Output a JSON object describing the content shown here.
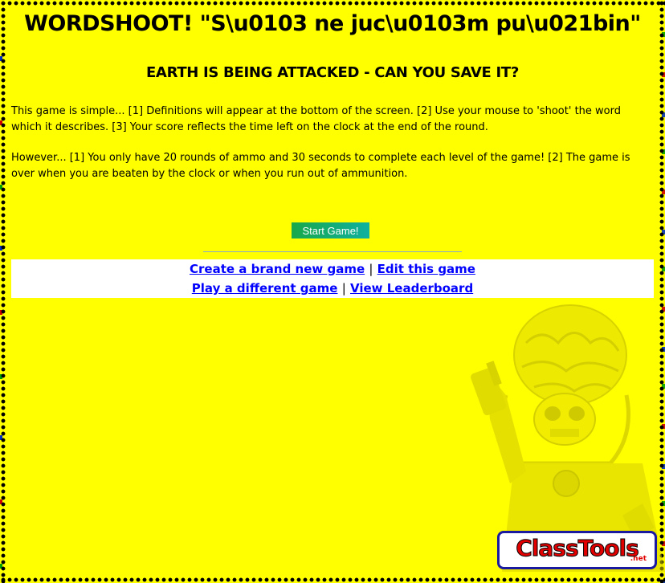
{
  "header": {
    "title": "WORDSHOOT! \"S\\u0103 ne juc\\u0103m pu\\u021bin\"",
    "subtitle": "EARTH IS BEING ATTACKED - CAN YOU SAVE IT?"
  },
  "instructions": {
    "paragraph1": "This game is simple... [1] Definitions will appear at the bottom of the screen. [2] Use your mouse to 'shoot' the word which it describes. [3] Your score reflects the time left on the clock at the end of the round.",
    "paragraph2": "However... [1] You only have 20 rounds of ammo and 30 seconds to complete each level of the game! [2] The game is over when you are beaten by the clock or when you run out of ammunition."
  },
  "start_button": {
    "label": "Start Game!"
  },
  "links": {
    "create": "Create a brand new game",
    "edit": "Edit this game",
    "play_different": "Play a different game",
    "leaderboard": "View Leaderboard",
    "separator": "|"
  },
  "logo": {
    "text": "ClassTools",
    "suffix": ".net"
  },
  "colors": {
    "background": "#ffff00",
    "link": "#0000ff",
    "button_start": "#1aa84a",
    "button_end": "#0fb0a0"
  },
  "icons": {
    "alien": "alien-image",
    "logo": "classtools-logo"
  }
}
